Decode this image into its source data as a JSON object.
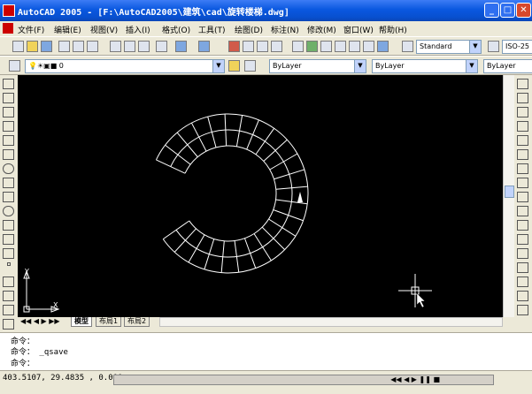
{
  "window": {
    "title": "AutoCAD 2005 - [F:\\AutoCAD2005\\建筑\\cad\\旋转楼梯.dwg]",
    "minimize": "_",
    "maximize": "□",
    "close": "✕"
  },
  "menu": [
    "文件(F)",
    "编辑(E)",
    "视图(V)",
    "插入(I)",
    "格式(O)",
    "工具(T)",
    "绘图(D)",
    "标注(N)",
    "修改(M)",
    "窗口(W)",
    "帮助(H)"
  ],
  "toolbar": {
    "text_style": "Standard",
    "dim_style": "ISO-25",
    "layer_value": "0",
    "color": "ByLayer",
    "linetype": "ByLayer",
    "lineweight": "ByLayer"
  },
  "tabs": {
    "model": "模型",
    "layout1": "布局1",
    "layout2": "布局2"
  },
  "ucs": {
    "x": "X",
    "y": "Y"
  },
  "command": {
    "lines": [
      "命令：",
      "命令：  _qsave",
      "命令："
    ]
  },
  "status": {
    "coordinates": "403.5107, 29.4835 , 0.000"
  },
  "colors": {
    "canvas": "#000000",
    "drawing": "#ffffff",
    "titlebar": "#0a58e0"
  }
}
